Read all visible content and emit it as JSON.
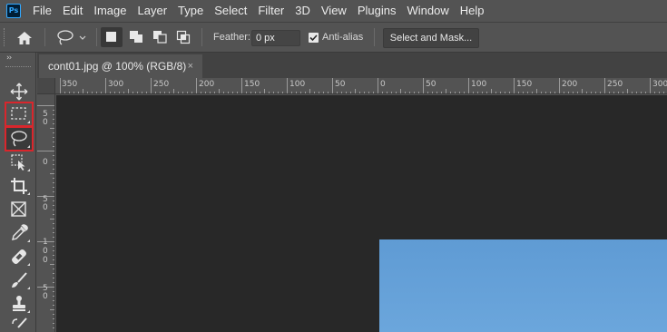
{
  "app": {
    "logo_text": "Ps"
  },
  "menu": [
    "File",
    "Edit",
    "Image",
    "Layer",
    "Type",
    "Select",
    "Filter",
    "3D",
    "View",
    "Plugins",
    "Window",
    "Help"
  ],
  "options_bar": {
    "feather_label": "Feather:",
    "feather_value": "0 px",
    "antialias_label": "Anti-alias",
    "antialias_checked": true,
    "select_and_mask_label": "Select and Mask..."
  },
  "document": {
    "tab_title": "cont01.jpg @ 100% (RGB/8)",
    "close_glyph": "×",
    "ruler_h_labels": [
      "350",
      "300",
      "250",
      "200",
      "150",
      "100",
      "50",
      "0",
      "50",
      "100",
      "150",
      "200",
      "250",
      "300"
    ],
    "ruler_v_labels": [
      "5 0",
      "0",
      "5 0",
      "1 0 0",
      "5 0"
    ]
  },
  "toolbar": {
    "collapse_glyph": "››",
    "tools": [
      "move-tool",
      "rectangular-marquee-tool",
      "lasso-tool",
      "object-selection-tool",
      "crop-tool",
      "frame-tool",
      "eyedropper-tool",
      "healing-brush-tool",
      "brush-tool",
      "clone-stamp-tool",
      "history-brush-tool"
    ],
    "selected_tool": "lasso-tool"
  },
  "colors": {
    "ui_bg": "#535353",
    "canvas_bg": "#282828",
    "highlight": "#d9262c",
    "photo_sky": "#6ba6dc"
  }
}
